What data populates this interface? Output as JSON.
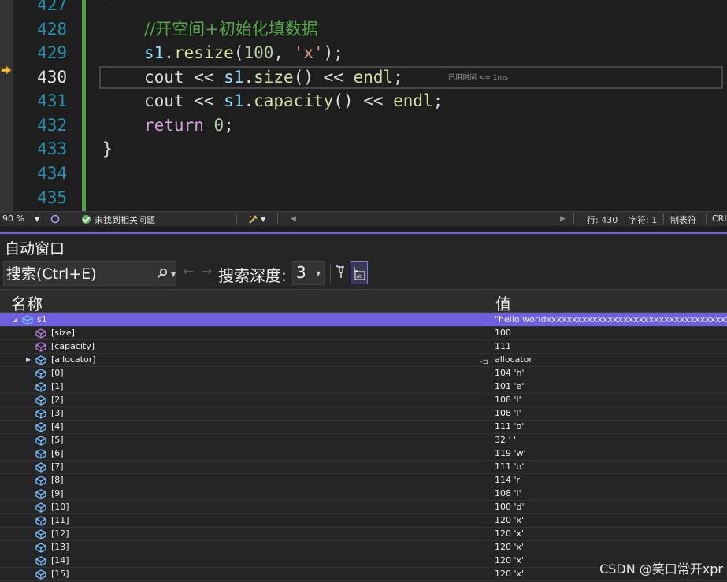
{
  "editor": {
    "lines": [
      {
        "num": "427"
      },
      {
        "num": "428"
      },
      {
        "num": "429"
      },
      {
        "num": "430"
      },
      {
        "num": "431"
      },
      {
        "num": "432"
      },
      {
        "num": "433"
      },
      {
        "num": "434"
      },
      {
        "num": "435"
      }
    ],
    "code": {
      "comment": "//开空间+初始化填数据",
      "l429": {
        "obj": "s1",
        "dot": ".",
        "fn": "resize",
        "open": "(",
        "num": "100",
        "comma": ", ",
        "str": "'x'",
        "close": ");"
      },
      "l430": {
        "cout": "cout",
        "op1": " << ",
        "obj": "s1",
        "dot": ".",
        "fn": "size",
        "call": "()",
        "op2": " << ",
        "endl": "endl",
        "semi": ";"
      },
      "l431": {
        "cout": "cout",
        "op1": " << ",
        "obj": "s1",
        "dot": ".",
        "fn": "capacity",
        "call": "()",
        "op2": " << ",
        "endl": "endl",
        "semi": ";"
      },
      "l432": {
        "kw": "return",
        "space": " ",
        "num": "0",
        "semi": ";"
      },
      "l433": "}"
    },
    "perf_tip": "已用时间 <= 1ms",
    "current_line": "430"
  },
  "statusbar": {
    "zoom": "90 %",
    "issues": "未找到相关问题",
    "line": "行: 430",
    "col": "字符: 1",
    "tabs": "制表符",
    "eol": "CRL"
  },
  "autos": {
    "title": "自动窗口",
    "search_placeholder": "搜索(Ctrl+E)",
    "depth_label": "搜索深度:",
    "depth_value": "3",
    "col_name": "名称",
    "col_value": "值",
    "rows": [
      {
        "name": "s1",
        "value": "\"hello worldxxxxxxxxxxxxxxxxxxxxxxxxxxxxxxxxxxxxxxxxxxxxxxxxxxxxxxxxxxxxxxxx"
      },
      {
        "name": "[size]",
        "value": "100"
      },
      {
        "name": "[capacity]",
        "value": "111"
      },
      {
        "name": "[allocator]",
        "value": "allocator"
      },
      {
        "name": "[0]",
        "value": "104 'h'"
      },
      {
        "name": "[1]",
        "value": "101 'e'"
      },
      {
        "name": "[2]",
        "value": "108 'l'"
      },
      {
        "name": "[3]",
        "value": "108 'l'"
      },
      {
        "name": "[4]",
        "value": "111 'o'"
      },
      {
        "name": "[5]",
        "value": "32 ' '"
      },
      {
        "name": "[6]",
        "value": "119 'w'"
      },
      {
        "name": "[7]",
        "value": "111 'o'"
      },
      {
        "name": "[8]",
        "value": "114 'r'"
      },
      {
        "name": "[9]",
        "value": "108 'l'"
      },
      {
        "name": "[10]",
        "value": "100 'd'"
      },
      {
        "name": "[11]",
        "value": "120 'x'"
      },
      {
        "name": "[12]",
        "value": "120 'x'"
      },
      {
        "name": "[13]",
        "value": "120 'x'"
      },
      {
        "name": "[14]",
        "value": "120 'x'"
      },
      {
        "name": "[15]",
        "value": "120 'x'"
      }
    ]
  },
  "watermark": "CSDN @笑口常开xpr",
  "colors": {
    "accent": "#6e5fe0",
    "change_bar": "#55a04a",
    "comment": "#57a64a",
    "identifier": "#9cdcfe",
    "function": "#dcdcaa",
    "keyword": "#d8a0df"
  }
}
